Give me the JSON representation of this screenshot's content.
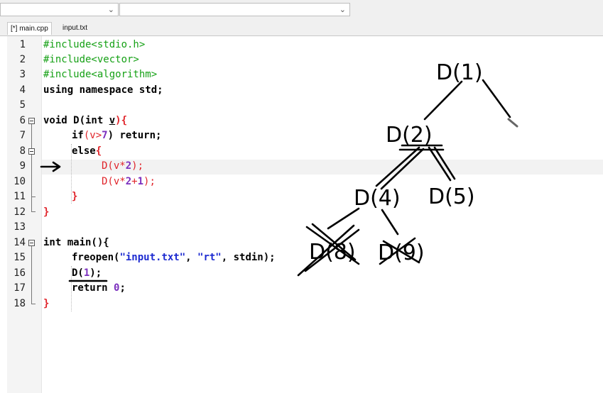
{
  "tabs": [
    {
      "label": "[*] main.cpp",
      "active": true
    },
    {
      "label": "input.txt",
      "active": false
    }
  ],
  "line_numbers": [
    "1",
    "2",
    "3",
    "4",
    "5",
    "6",
    "7",
    "8",
    "9",
    "10",
    "11",
    "12",
    "13",
    "14",
    "15",
    "16",
    "17",
    "18"
  ],
  "code": {
    "l1": "#include<stdio.h>",
    "l2": "#include<vector>",
    "l3": "#include<algorithm>",
    "l4_kw": "using namespace std",
    "l4_semi": ";",
    "l6_a": "void D(int ",
    "l6_v": "v",
    "l6_b": "){",
    "l7_a": "if",
    "l7_b": "(v>",
    "l7_n": "7",
    "l7_c": ") return;",
    "l8_a": "else",
    "l8_b": "{",
    "l9_a": "D(v*",
    "l9_n": "2",
    "l9_b": ");",
    "l10_a": "D(v*",
    "l10_n1": "2",
    "l10_p": "+",
    "l10_n2": "1",
    "l10_b": ");",
    "l11": "}",
    "l12": "}",
    "l14_a": "int main(){",
    "l15_a": "freopen(",
    "l15_s1": "\"input.txt\"",
    "l15_c1": ", ",
    "l15_s2": "\"rt\"",
    "l15_c2": ", stdin);",
    "l16_a": "D(",
    "l16_n": "1",
    "l16_b": ");",
    "l17_a": "return ",
    "l17_n": "0",
    "l17_b": ";",
    "l18": "}"
  },
  "annotations": {
    "n1": "D(1)",
    "n2": "D(2)",
    "n4": "D(4)",
    "n5": "D(5)",
    "n8": "D(8)",
    "n9": "D(9)"
  },
  "colors": {
    "preprocessor": "#16a116",
    "bracket": "#e0242a",
    "number": "#7b2fbe",
    "string": "#1d2bd1",
    "ink": "#000000"
  }
}
